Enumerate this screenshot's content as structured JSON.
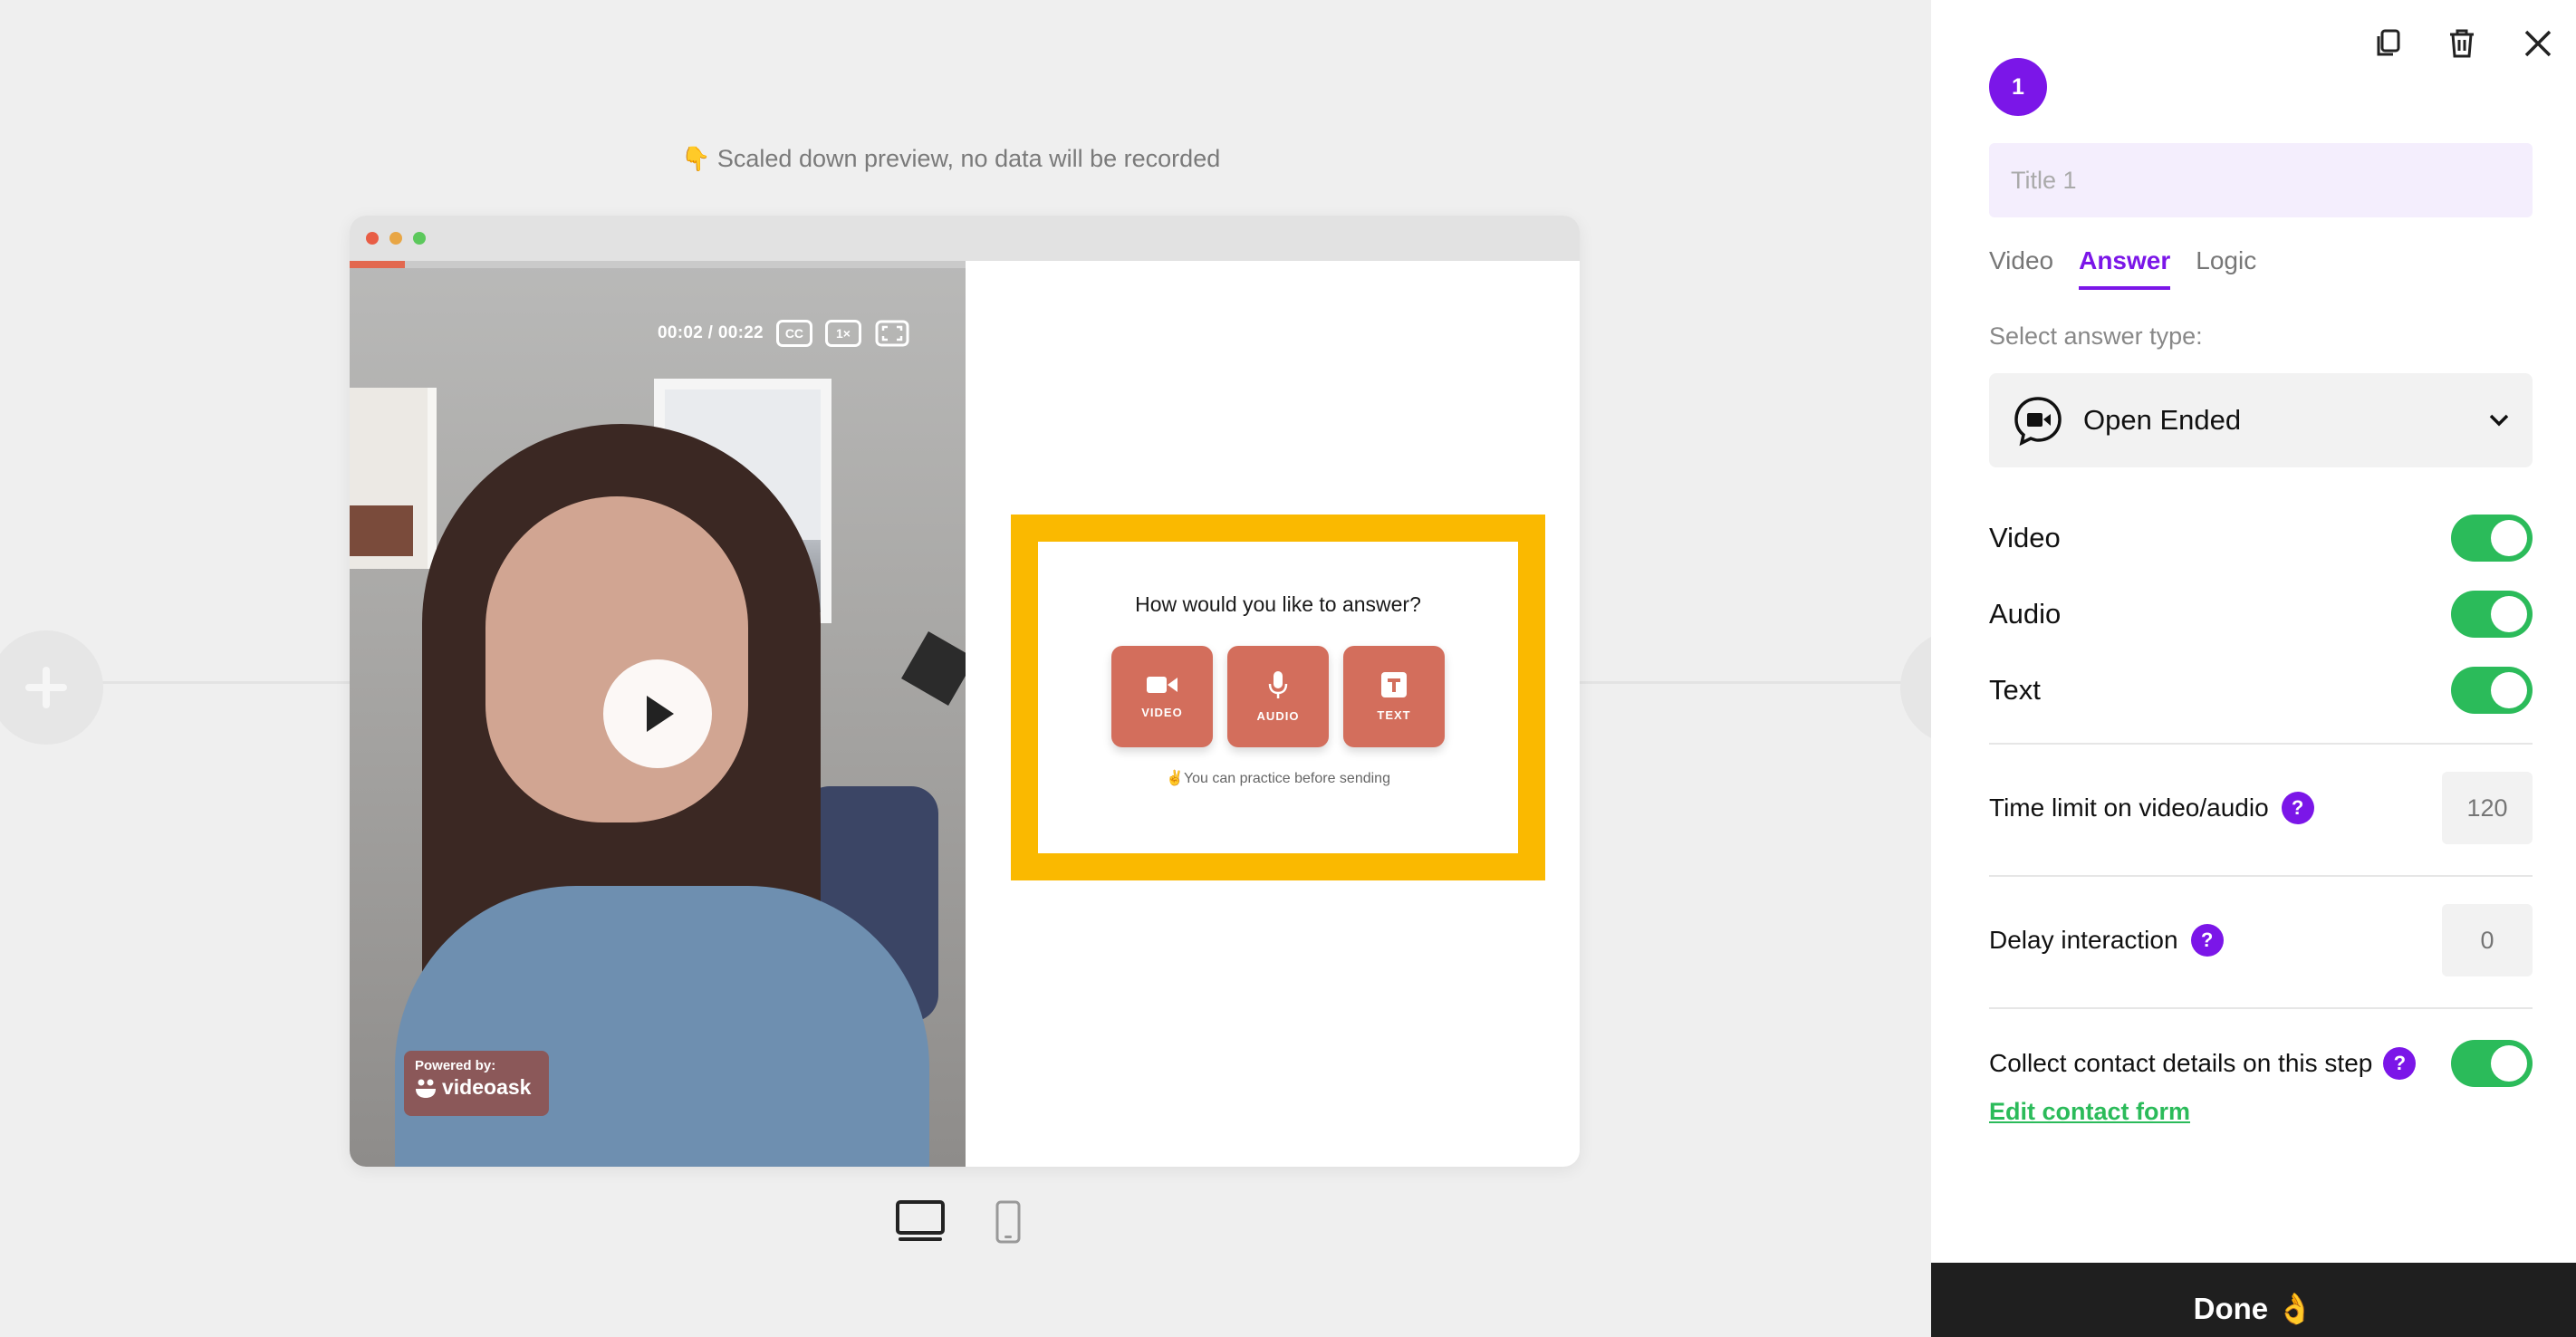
{
  "preview": {
    "note_icon": "👇",
    "note": "Scaled down preview, no data will be recorded"
  },
  "video": {
    "time": "00:02 / 00:22",
    "cc_label": "CC",
    "speed_label": "1×",
    "progress_fraction": 0.09,
    "powered_by": "Powered by:",
    "brand": "videoask"
  },
  "answer_card": {
    "question": "How would you like to answer?",
    "buttons": [
      "VIDEO",
      "AUDIO",
      "TEXT"
    ],
    "note": "✌️You can practice before sending"
  },
  "panel": {
    "step_number": "1",
    "title_placeholder": "Title 1",
    "tabs": [
      "Video",
      "Answer",
      "Logic"
    ],
    "active_tab": "Answer",
    "select_label": "Select answer type:",
    "answer_type": "Open Ended",
    "toggles": [
      {
        "label": "Video",
        "on": true
      },
      {
        "label": "Audio",
        "on": true
      },
      {
        "label": "Text",
        "on": true
      }
    ],
    "time_limit": {
      "label": "Time limit on video/audio",
      "placeholder": "120"
    },
    "delay": {
      "label": "Delay interaction",
      "placeholder": "0"
    },
    "contact": {
      "label": "Collect contact details on this step",
      "on": true
    },
    "edit_contact": "Edit contact form",
    "done": "Done 👌",
    "help_glyph": "?"
  },
  "colors": {
    "accent_purple": "#7b16e8",
    "toggle_green": "#2bbb5a",
    "answer_box": "#fab900",
    "answer_button": "#d36e5c",
    "done_bar": "#1f1f1f"
  },
  "icons": [
    "copy-icon",
    "trash-icon",
    "close-icon",
    "play-icon",
    "fullscreen-icon",
    "video-camera-icon",
    "microphone-icon",
    "text-icon",
    "open-ended-icon",
    "chevron-down-icon",
    "desktop-icon",
    "mobile-icon",
    "plus-icon"
  ]
}
